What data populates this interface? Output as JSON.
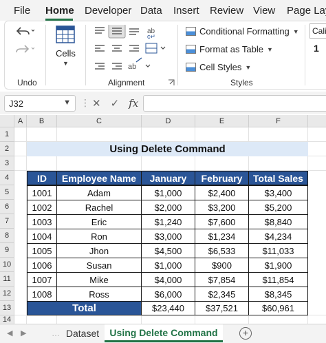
{
  "menu": {
    "items": [
      "File",
      "Home",
      "Developer",
      "Data",
      "Insert",
      "Review",
      "View",
      "Page Lay"
    ]
  },
  "ribbon": {
    "cells_label": "Cells",
    "groups": {
      "undo": "Undo",
      "alignment": "Alignment",
      "styles": "Styles"
    },
    "styles_items": [
      "Conditional Formatting",
      "Format as Table",
      "Cell Styles"
    ],
    "font_partial": "Cali",
    "font_size_partial": "1"
  },
  "formula_bar": {
    "name_box": "J32",
    "fx_label": "fx",
    "formula": ""
  },
  "columns": [
    "A",
    "B",
    "C",
    "D",
    "E",
    "F"
  ],
  "rows": [
    "1",
    "2",
    "3",
    "4",
    "5",
    "6",
    "7",
    "8",
    "9",
    "10",
    "11",
    "12",
    "13",
    "14"
  ],
  "sheet": {
    "title": "Using Delete Command",
    "headers": [
      "ID",
      "Employee Name",
      "January",
      "February",
      "Total Sales"
    ],
    "data": [
      [
        "1001",
        "Adam",
        "$1,000",
        "$2,400",
        "$3,400"
      ],
      [
        "1002",
        "Rachel",
        "$2,000",
        "$3,200",
        "$5,200"
      ],
      [
        "1003",
        "Eric",
        "$1,240",
        "$7,600",
        "$8,840"
      ],
      [
        "1004",
        "Ron",
        "$3,000",
        "$1,234",
        "$4,234"
      ],
      [
        "1005",
        "Jhon",
        "$4,500",
        "$6,533",
        "$11,033"
      ],
      [
        "1006",
        "Susan",
        "$1,000",
        "$900",
        "$1,900"
      ],
      [
        "1007",
        "Mike",
        "$4,000",
        "$7,854",
        "$11,854"
      ],
      [
        "1008",
        "Ross",
        "$6,000",
        "$2,345",
        "$8,345"
      ]
    ],
    "total": [
      "Total",
      "$23,440",
      "$37,521",
      "$60,961"
    ]
  },
  "tabs": {
    "sheets": [
      "Dataset",
      "Using Delete Command"
    ],
    "active": "Using Delete Command"
  },
  "colors": {
    "accent": "#217346",
    "header_fill": "#2a5597",
    "title_fill": "#dde9f7"
  }
}
